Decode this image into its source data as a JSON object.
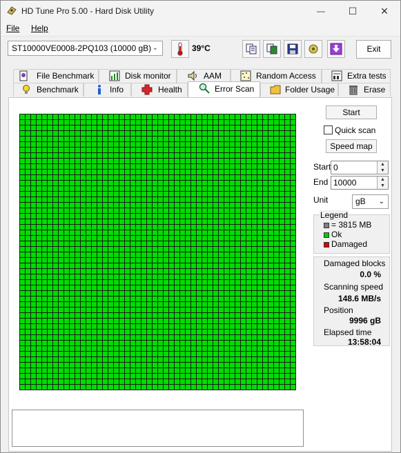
{
  "window": {
    "title": "HD Tune Pro 5.00 - Hard Disk Utility",
    "controls": {
      "minimize": "—",
      "maximize": "☐",
      "close": "✕"
    }
  },
  "menu": {
    "file": "File",
    "help": "Help"
  },
  "toolbar": {
    "drive": "ST10000VE0008-2PQ103 (10000 gB)",
    "temperature": "39°C",
    "exit": "Exit"
  },
  "tabs_top": [
    {
      "label": "File Benchmark",
      "icon": "file-benchmark-icon"
    },
    {
      "label": "Disk monitor",
      "icon": "disk-monitor-icon"
    },
    {
      "label": "AAM",
      "icon": "speaker-icon"
    },
    {
      "label": "Random Access",
      "icon": "random-access-icon"
    },
    {
      "label": "Extra tests",
      "icon": "extra-tests-icon"
    }
  ],
  "tabs_bottom": [
    {
      "label": "Benchmark",
      "icon": "lightbulb-icon"
    },
    {
      "label": "Info",
      "icon": "info-icon"
    },
    {
      "label": "Health",
      "icon": "health-cross-icon"
    },
    {
      "label": "Error Scan",
      "icon": "magnifier-icon",
      "active": true
    },
    {
      "label": "Folder Usage",
      "icon": "folder-icon"
    },
    {
      "label": "Erase",
      "icon": "trash-icon"
    }
  ],
  "scan": {
    "start_button": "Start",
    "quick_scan": "Quick scan",
    "quick_scan_checked": false,
    "speed_map": "Speed map",
    "start_label": "Start",
    "start_value": "0",
    "end_label": "End",
    "end_value": "10000",
    "unit_label": "Unit",
    "unit_value": "gB",
    "block_state": "ok",
    "block_color": "#00dd00"
  },
  "legend": {
    "title": "Legend",
    "block_size": "= 3815 MB",
    "ok": "Ok",
    "damaged": "Damaged",
    "colors": {
      "block": "#808080",
      "ok": "#00cc00",
      "damaged": "#dd0000"
    }
  },
  "stats": {
    "damaged_blocks_label": "Damaged blocks",
    "damaged_blocks_value": "0.0 %",
    "scanning_speed_label": "Scanning speed",
    "scanning_speed_value": "148.6 MB/s",
    "position_label": "Position",
    "position_value": "9996 gB",
    "elapsed_label": "Elapsed time",
    "elapsed_value": "13:58:04"
  }
}
